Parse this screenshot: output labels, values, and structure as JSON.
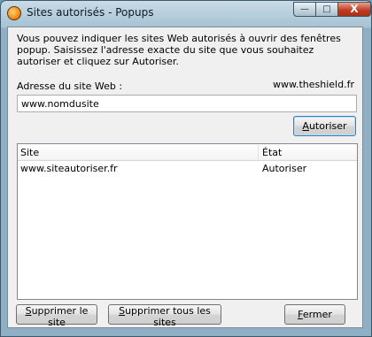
{
  "window": {
    "title": "Sites autorisés - Popups"
  },
  "controls": {
    "min": "—",
    "max": "□",
    "close": "X"
  },
  "intro": "Vous pouvez indiquer les sites Web autorisés à ouvrir des fenêtres popup. Saisissez l'adresse exacte du site que vous souhaitez autoriser et cliquez sur Autoriser.",
  "url": {
    "label": "Adresse du site Web :",
    "value": "www.nomdusite"
  },
  "brand": "www.theshield.fr",
  "buttons": {
    "allow_first": "A",
    "allow_rest": "utoriser",
    "remove_first": "S",
    "remove_rest": "upprimer le site",
    "remove_all_first": "S",
    "remove_all_rest": "upprimer tous les sites",
    "close_first": "F",
    "close_rest": "ermer"
  },
  "table": {
    "headers": [
      "Site",
      "État"
    ],
    "rows": [
      {
        "site": "www.siteautoriser.fr",
        "state": "Autoriser"
      }
    ]
  }
}
